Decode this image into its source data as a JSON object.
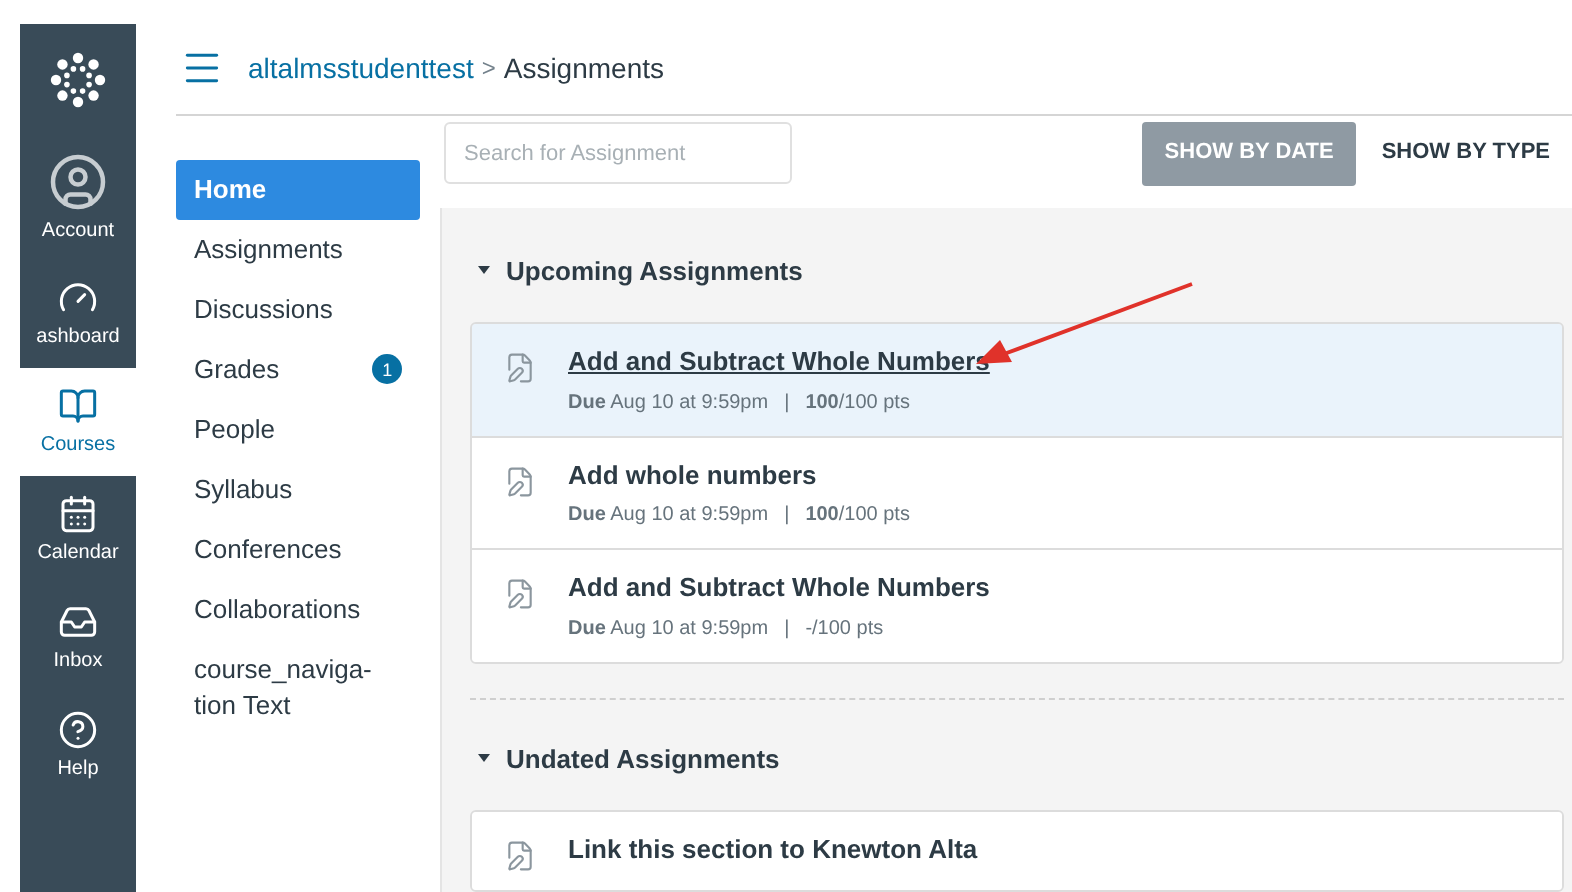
{
  "global_nav": [
    {
      "kind": "logo",
      "selected": false
    },
    {
      "kind": "account",
      "label": "Account",
      "selected": false
    },
    {
      "kind": "dashboard",
      "label": "ashboard",
      "selected": false
    },
    {
      "kind": "courses",
      "label": "Courses",
      "selected": true
    },
    {
      "kind": "calendar",
      "label": "Calendar",
      "selected": false
    },
    {
      "kind": "inbox",
      "label": "Inbox",
      "selected": false
    },
    {
      "kind": "help",
      "label": "Help",
      "selected": false
    }
  ],
  "breadcrumb": {
    "course": "altalmsstudenttest",
    "separator": ">",
    "page": "Assignments"
  },
  "course_nav": [
    {
      "label": "Home",
      "selected": true
    },
    {
      "label": "Assignments",
      "selected": false
    },
    {
      "label": "Discussions",
      "selected": false
    },
    {
      "label": "Grades",
      "selected": false,
      "badge": "1"
    },
    {
      "label": "People",
      "selected": false
    },
    {
      "label": "Syllabus",
      "selected": false
    },
    {
      "label": "Conferences",
      "selected": false
    },
    {
      "label": "Collaborations",
      "selected": false
    },
    {
      "label": "course_naviga-tion Text",
      "selected": false
    }
  ],
  "search": {
    "placeholder": "Search for Assignment"
  },
  "view_buttons": [
    {
      "label": "SHOW BY DATE",
      "selected": true
    },
    {
      "label": "SHOW BY TYPE",
      "selected": false
    }
  ],
  "groups": [
    {
      "title": "Upcoming Assignments",
      "expanded": true,
      "items": [
        {
          "title": "Add and Subtract Whole Numbers",
          "due": "**Due** Aug 10 at 9:59pm",
          "separator": "|",
          "points": "**100**/100 pts",
          "highlighted": true
        },
        {
          "title": "Add whole numbers",
          "due": "**Due** Aug 10 at 9:59pm",
          "separator": "|",
          "points": "**100**/100 pts",
          "highlighted": false
        },
        {
          "title": "Add and Subtract Whole Numbers",
          "due": "**Due** Aug 10 at 9:59pm",
          "separator": "|",
          "points": "-/100 pts",
          "highlighted": false
        }
      ]
    },
    {
      "title": "Undated Assignments",
      "expanded": true,
      "items": [
        {
          "title": "Link this section to Knewton Alta",
          "highlighted": false
        }
      ]
    }
  ]
}
